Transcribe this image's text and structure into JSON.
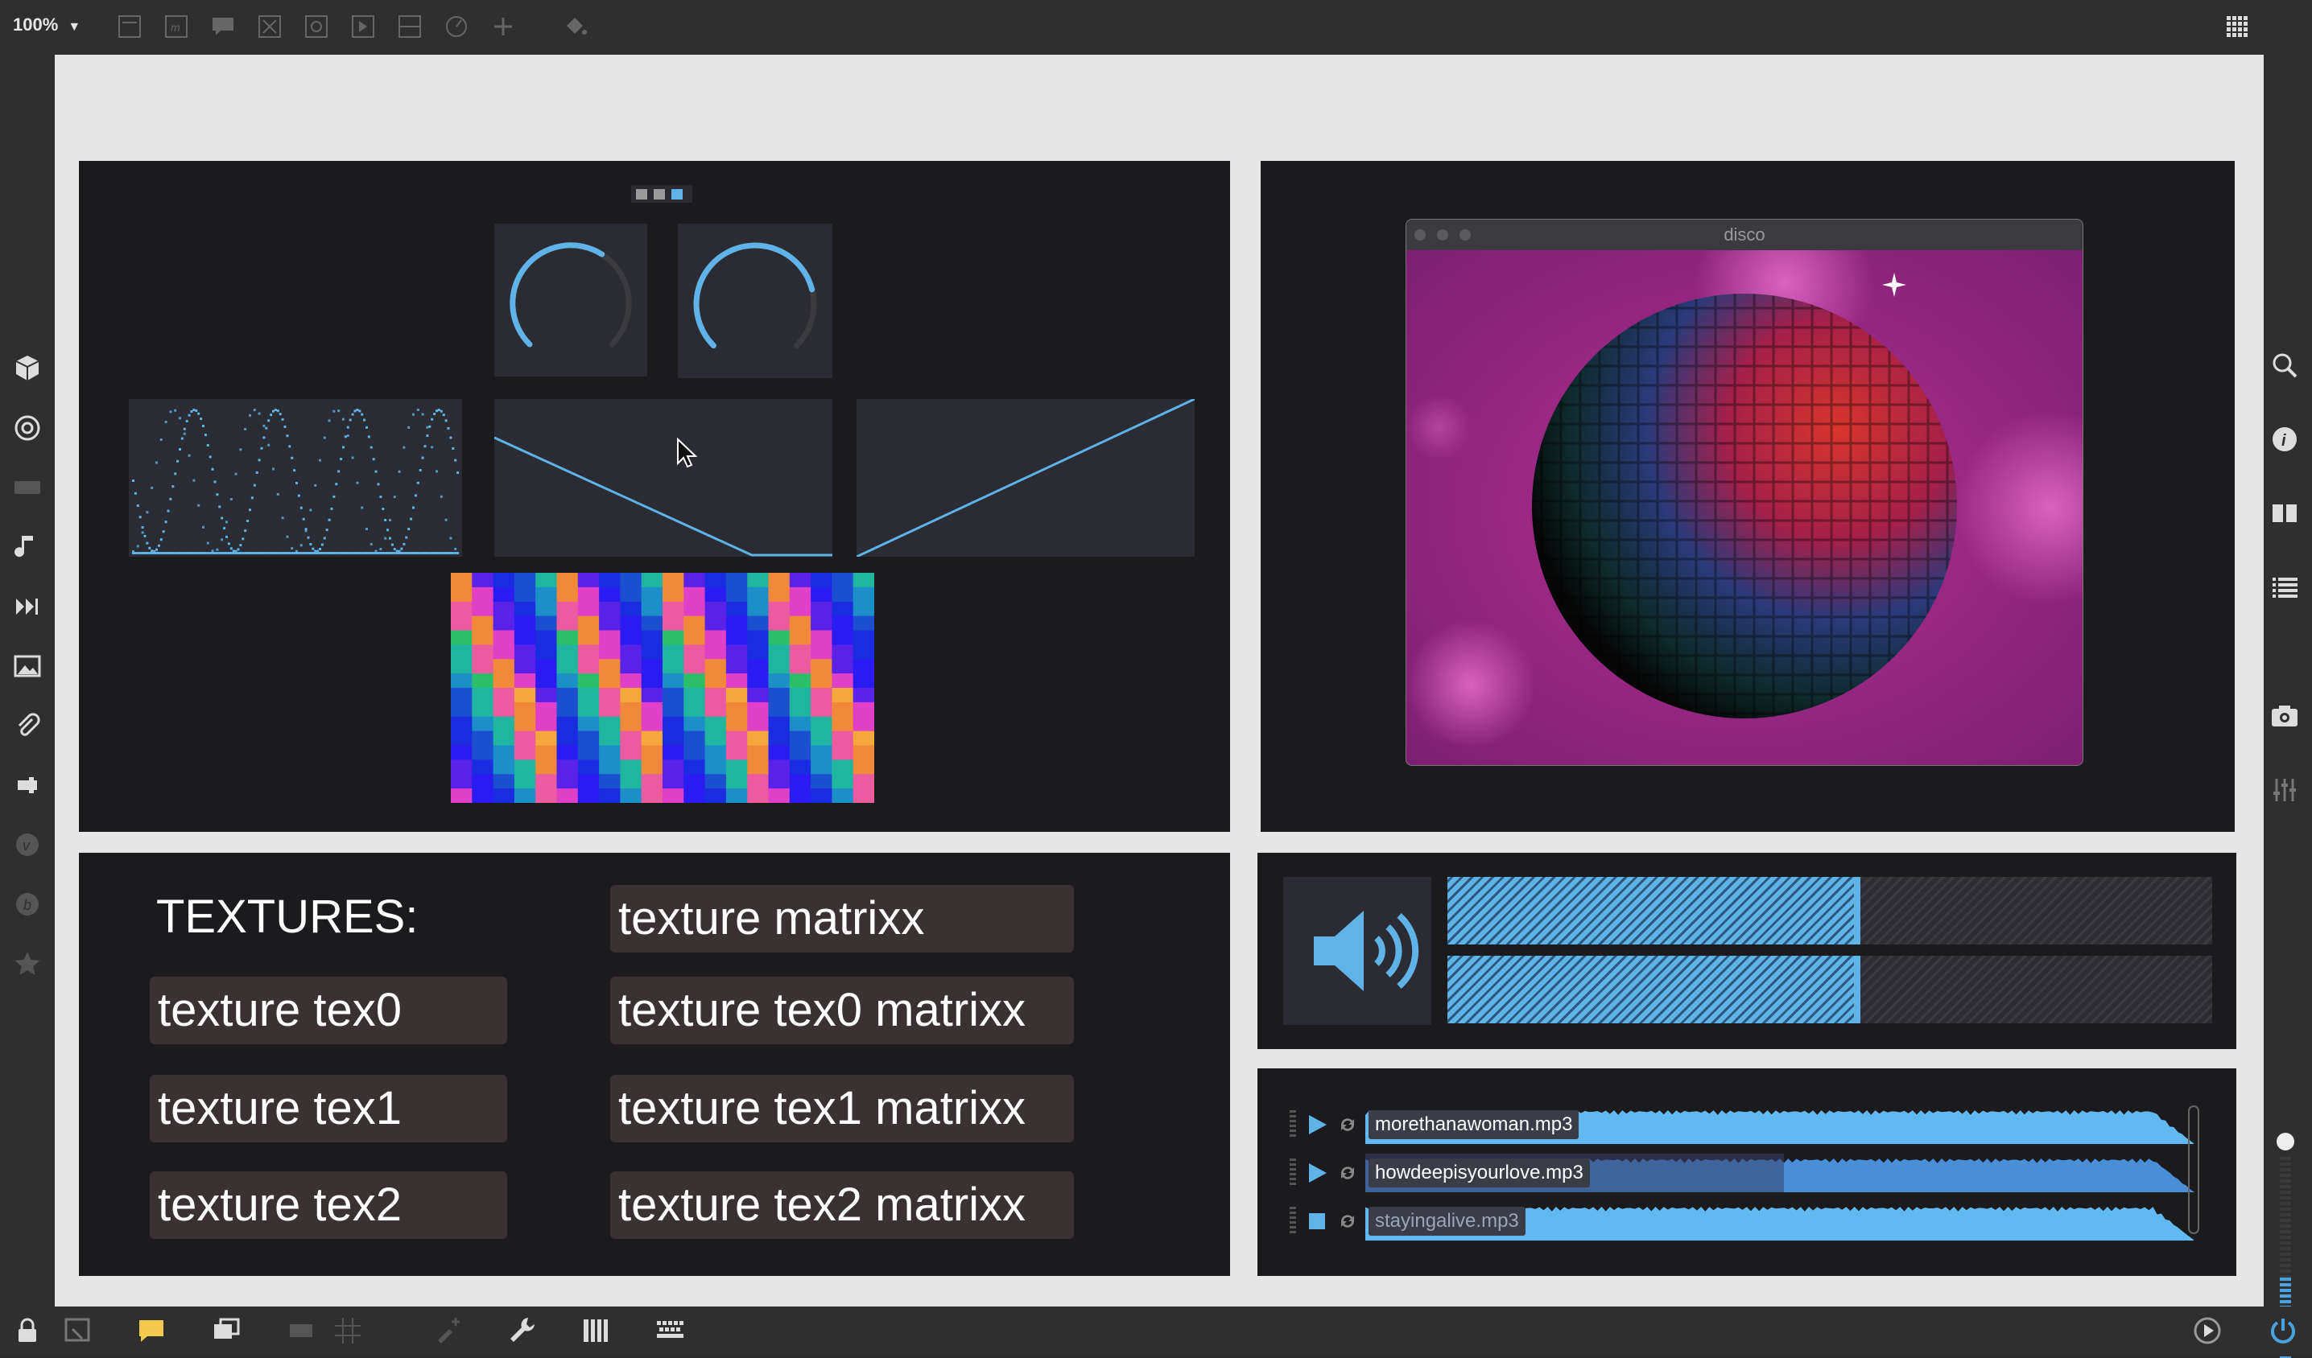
{
  "toolbar": {
    "zoom_label": "100%",
    "icons": [
      "object-box-icon",
      "message-box-icon",
      "comment-icon",
      "button-icon",
      "toggle-icon",
      "number-icon",
      "slider-icon",
      "dial-icon",
      "plus-icon",
      "paint-bucket-icon",
      "grid-menu-icon"
    ]
  },
  "left_sidebar": {
    "icons": [
      "package-icon",
      "target-icon",
      "media-strip-icon",
      "music-note-icon",
      "step-forward-icon",
      "image-icon",
      "paperclip-icon",
      "plugin-icon",
      "v-badge-icon",
      "info-italic-icon",
      "star-icon"
    ]
  },
  "right_sidebar": {
    "icons": [
      "search-icon",
      "info-icon",
      "book-icon",
      "list-icon",
      "camera-icon",
      "mixer-sliders-icon"
    ]
  },
  "bottom_bar": {
    "icons": [
      "lock-icon",
      "presentation-icon",
      "comment-yellow-icon",
      "windows-icon",
      "dim-icon",
      "grid-icon",
      "brush-plus-icon",
      "wrench-icon",
      "piano-icon",
      "keyboard-icon",
      "play-circle-icon",
      "power-icon"
    ]
  },
  "viewer": {
    "window_title": "disco"
  },
  "controls": {
    "tabs": [
      "tab-1",
      "tab-2",
      "tab-3"
    ],
    "dial_1_value": 0.62,
    "dial_2_value": 0.78
  },
  "textures": {
    "heading": "TEXTURES:",
    "left_buttons": [
      "texture tex0",
      "texture tex1",
      "texture tex2"
    ],
    "right_buttons": [
      "texture matrixx",
      "texture tex0 matrixx",
      "texture tex1 matrixx",
      "texture tex2 matrixx"
    ]
  },
  "meter": {
    "level_1": 0.54,
    "level_2": 0.54
  },
  "playlist": {
    "tracks": [
      {
        "file": "morethanawoman.mp3",
        "state": "play"
      },
      {
        "file": "howdeepisyourlove.mp3",
        "state": "play"
      },
      {
        "file": "stayingalive.mp3",
        "state": "stop"
      }
    ]
  },
  "colors": {
    "accent": "#5fb3e6",
    "panel": "#1b1a1d",
    "canvas": "#e6e6e6",
    "button": "#3a3232"
  }
}
